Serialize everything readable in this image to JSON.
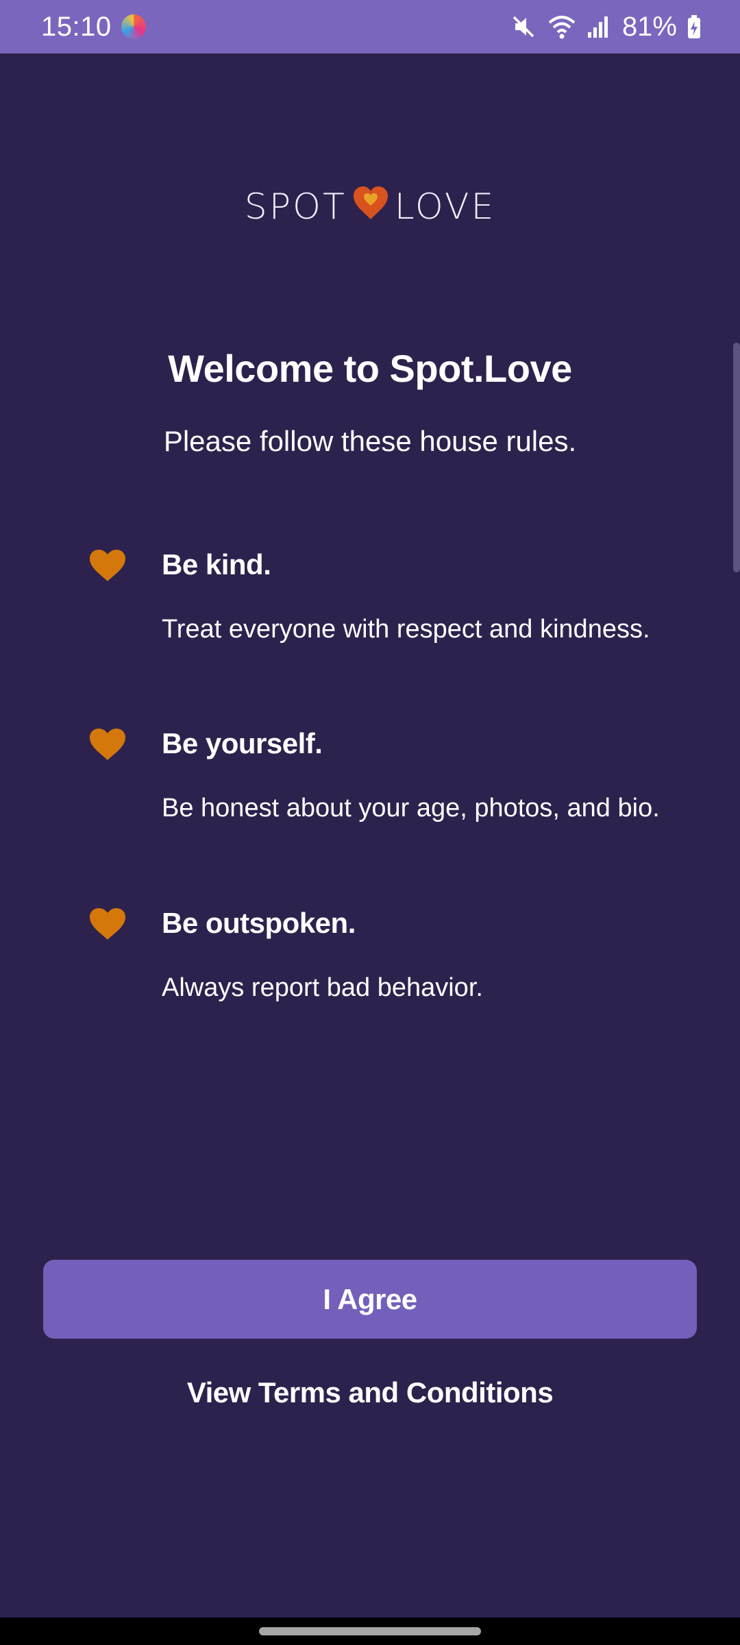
{
  "status_bar": {
    "time": "15:10",
    "battery": "81%",
    "icons": [
      "app-notification-icon",
      "mute-icon",
      "wifi-icon",
      "signal-icon",
      "battery-charging-icon"
    ]
  },
  "logo": {
    "left": "SPOT",
    "right": "LOVE",
    "heart_color": "#d9531e"
  },
  "welcome": {
    "title": "Welcome to Spot.Love",
    "subtitle": "Please follow these house rules."
  },
  "rules": [
    {
      "title": "Be kind.",
      "description": "Treat everyone with respect and kindness."
    },
    {
      "title": "Be yourself.",
      "description": "Be honest about your age, photos, and bio."
    },
    {
      "title": "Be outspoken.",
      "description": "Always report bad behavior."
    }
  ],
  "actions": {
    "agree_label": "I Agree",
    "terms_label": "View Terms and Conditions"
  },
  "colors": {
    "background": "#2d224d",
    "accent": "#7460bb",
    "status_bar": "#7b66bd",
    "heart": "#d4780b"
  }
}
